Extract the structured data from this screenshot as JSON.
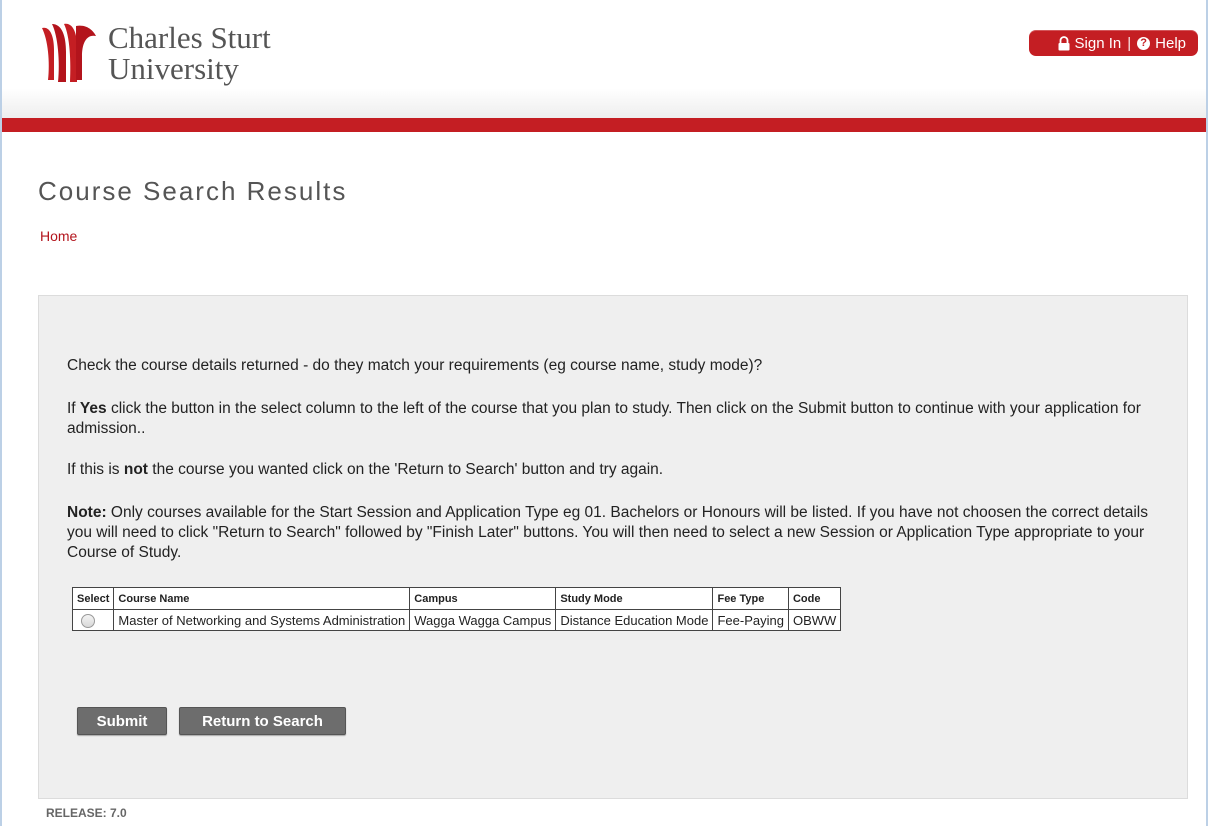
{
  "header": {
    "logo_line1": "Charles Sturt",
    "logo_line2": "University",
    "sign_in": "Sign In",
    "separator": "|",
    "help": "Help",
    "help_icon_glyph": "?",
    "brand_color": "#c41e23"
  },
  "page": {
    "title": "Course Search Results",
    "breadcrumb": "Home"
  },
  "instructions": {
    "p1": "Check the course details returned - do they match your requirements (eg course name, study mode)?",
    "p2_before": "If ",
    "p2_bold": "Yes",
    "p2_after": " click the button in the select column to the left of the course that you plan to study. Then click on the Submit button to continue with your application for admission..",
    "p3_before": "If this is ",
    "p3_bold": "not",
    "p3_after": " the course you wanted click on the 'Return to Search' button and try again.",
    "p4_bold": "Note:",
    "p4_after": " Only courses available for the Start Session and Application Type eg 01. Bachelors or Honours will be listed. If you have not choosen the correct details you will need to click \"Return to Search\" followed by \"Finish Later\" buttons. You will then need to select a new Session or Application Type appropriate to your Course of Study."
  },
  "table": {
    "headers": [
      "Select",
      "Course Name",
      "Campus",
      "Study Mode",
      "Fee Type",
      "Code"
    ],
    "rows": [
      {
        "course_name": "Master of Networking and Systems Administration",
        "campus": "Wagga Wagga Campus",
        "study_mode": "Distance Education Mode",
        "fee_type": "Fee-Paying",
        "code": "OBWW"
      }
    ]
  },
  "buttons": {
    "submit": "Submit",
    "return_to_search": "Return to Search"
  },
  "footer": {
    "release": "RELEASE: 7.0"
  },
  "icons": {
    "logo": "csu-logo-mark",
    "lock": "lock-icon",
    "help": "help-circle-icon",
    "radio": "radio-button"
  }
}
